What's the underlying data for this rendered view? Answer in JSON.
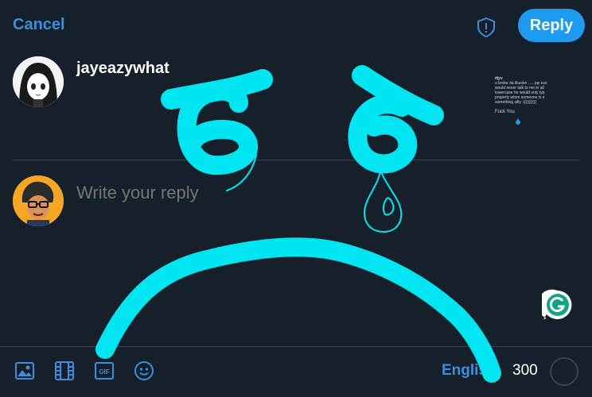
{
  "header": {
    "cancel_label": "Cancel",
    "reply_label": "Reply"
  },
  "original_post": {
    "username": "jayeazywhat",
    "thumbnail_lines": [
      "#jyv",
      "u broke da illusion ..... jay ezz",
      "would never talk to me in all",
      "lowercase he would only typ",
      "properly when someone is s",
      "something silly :((((((((((",
      "",
      "Fuck You"
    ]
  },
  "compose": {
    "placeholder": "Write your reply"
  },
  "footer": {
    "language": "English",
    "char_count": "300"
  },
  "colors": {
    "background": "#15202b",
    "accent": "#1d9bf0",
    "link": "#3c8fe0",
    "doodle": "#00e5f2",
    "divider": "#38444d",
    "placeholder": "#8b98a5"
  },
  "icons": [
    "shield-icon",
    "image-icon",
    "film-icon",
    "gif-icon",
    "emoji-icon",
    "grammarly-icon"
  ]
}
